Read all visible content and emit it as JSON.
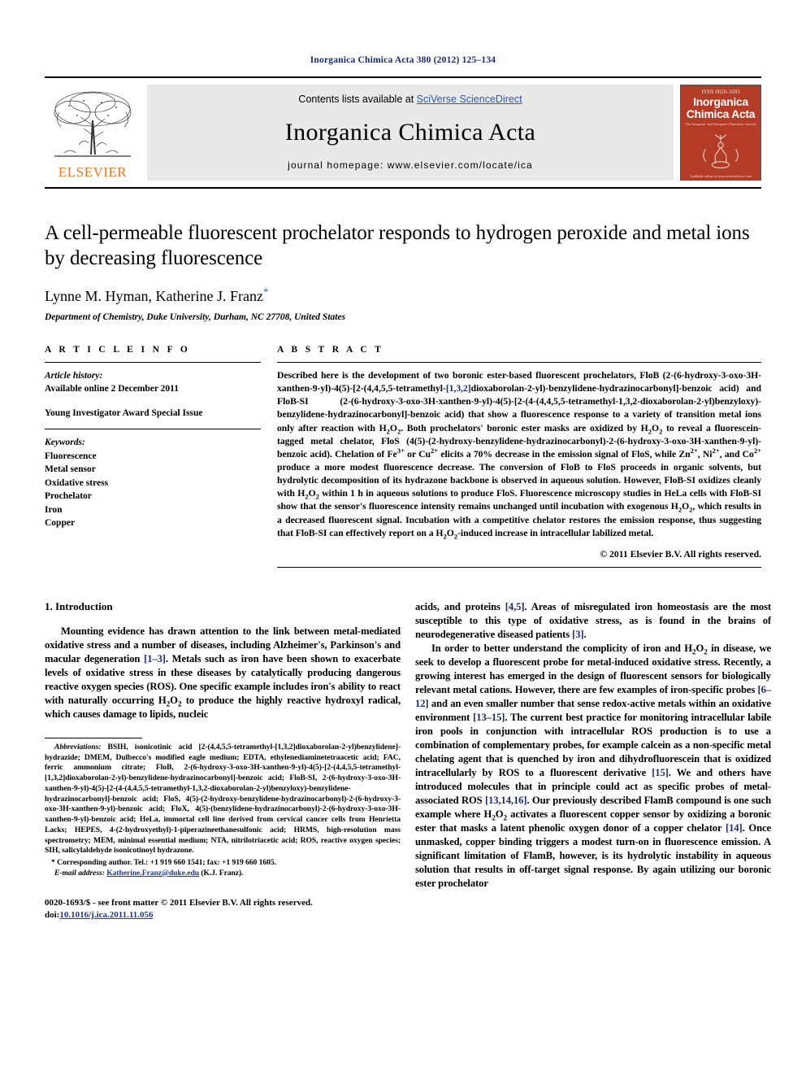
{
  "running_head": "Inorganica Chimica Acta 380 (2012) 125–134",
  "banner": {
    "publisher_name": "ELSEVIER",
    "contents_prefix": "Contents lists available at ",
    "contents_link": "SciVerse ScienceDirect",
    "journal_name": "Inorganica Chimica Acta",
    "homepage": "journal homepage: www.elsevier.com/locate/ica",
    "cover": {
      "issn_top": "ISSN 0020-1693",
      "title_line1": "Inorganica",
      "title_line2": "Chimica Acta",
      "subtitle": "The Inorganic and Inorganic Chemistry Journal",
      "footer": "Available online at www.sciencedirect.com"
    }
  },
  "article": {
    "title": "A cell-permeable fluorescent prochelator responds to hydrogen peroxide and metal ions by decreasing fluorescence",
    "authors": "Lynne M. Hyman, Katherine J. Franz",
    "corresponding_marker": "*",
    "affiliation": "Department of Chemistry, Duke University, Durham, NC 27708, United States"
  },
  "article_info": {
    "heading": "A R T I C L E    I N F O",
    "history_label": "Article history:",
    "history_value": "Available online 2 December 2011",
    "special_issue": "Young Investigator Award Special Issue",
    "keywords_label": "Keywords:",
    "keywords": [
      "Fluorescence",
      "Metal sensor",
      "Oxidative stress",
      "Prochelator",
      "Iron",
      "Copper"
    ]
  },
  "abstract": {
    "heading": "A B S T R A C T",
    "text": "Described here is the development of two boronic ester-based fluorescent prochelators, FloB (2-(6-hydroxy-3-oxo-3H-xanthen-9-yl)-4(5)-[2-(4,4,5,5-tetramethyl-[1,3,2]dioxaborolan-2-yl)-benzylidene-hydrazinocarbonyl]-benzoic acid) and FloB-SI (2-(6-hydroxy-3-oxo-3H-xanthen-9-yl)-4(5)-[2-(4-(4,4,5,5-tetramethyl-1,3,2-dioxaborolan-2-yl)benzyloxy)-benzylidene-hydrazinocarbonyl]-benzoic acid) that show a fluorescence response to a variety of transition metal ions only after reaction with H2O2. Both prochelators' boronic ester masks are oxidized by H2O2 to reveal a fluorescein-tagged metal chelator, FloS (4(5)-(2-hydroxy-benzylidene-hydrazinocarbonyl)-2-(6-hydroxy-3-oxo-3H-xanthen-9-yl)-benzoic acid). Chelation of Fe3+ or Cu2+ elicits a 70% decrease in the emission signal of FloS, while Zn2+, Ni2+, and Co2+ produce a more modest fluorescence decrease. The conversion of FloB to FloS proceeds in organic solvents, but hydrolytic decomposition of its hydrazone backbone is observed in aqueous solution. However, FloB-SI oxidizes cleanly with H2O2 within 1 h in aqueous solutions to produce FloS. Fluorescence microscopy studies in HeLa cells with FloB-SI show that the sensor's fluorescence intensity remains unchanged until incubation with exogenous H2O2, which results in a decreased fluorescent signal. Incubation with a competitive chelator restores the emission response, thus suggesting that FloB-SI can effectively report on a H2O2-induced increase in intracellular labilized metal.",
    "copyright": "© 2011 Elsevier B.V. All rights reserved."
  },
  "body": {
    "section_number_title": "1. Introduction",
    "left_paragraph_1": "Mounting evidence has drawn attention to the link between metal-mediated oxidative stress and a number of diseases, including Alzheimer's, Parkinson's and macular degeneration [1–3]. Metals such as iron have been shown to exacerbate levels of oxidative stress in these diseases by catalytically producing dangerous reactive oxygen species (ROS). One specific example includes iron's ability to react with naturally occurring H2O2 to produce the highly reactive hydroxyl radical, which causes damage to lipids, nucleic",
    "right_paragraph_1_cont": "acids, and proteins [4,5]. Areas of misregulated iron homeostasis are the most susceptible to this type of oxidative stress, as is found in the brains of neurodegenerative diseased patients [3].",
    "right_paragraph_2": "In order to better understand the complicity of iron and H2O2 in disease, we seek to develop a fluorescent probe for metal-induced oxidative stress. Recently, a growing interest has emerged in the design of fluorescent sensors for biologically relevant metal cations. However, there are few examples of iron-specific probes [6–12] and an even smaller number that sense redox-active metals within an oxidative environment [13–15]. The current best practice for monitoring intracellular labile iron pools in conjunction with intracellular ROS production is to use a combination of complementary probes, for example calcein as a non-specific metal chelating agent that is quenched by iron and dihydrofluorescein that is oxidized intracellularly by ROS to a fluorescent derivative [15]. We and others have introduced molecules that in principle could act as specific probes of metal-associated ROS [13,14,16]. Our previously described FlamB compound is one such example where H2O2 activates a fluorescent copper sensor by oxidizing a boronic ester that masks a latent phenolic oxygen donor of a copper chelator [14]. Once unmasked, copper binding triggers a modest turn-on in fluorescence emission. A significant limitation of FlamB, however, is its hydrolytic instability in aqueous solution that results in off-target signal response. By again utilizing our boronic ester prochelator"
  },
  "footnotes": {
    "abbrev_label": "Abbreviations:",
    "abbrev_text": "BSIH, isonicotinic acid [2-(4,4,5,5-tetramethyl-[1,3,2]dioxaborolan-2-yl)benzylidene]-hydrazide; DMEM, Dulbecco's modified eagle medium; EDTA, ethylenediaminetetraacetic acid; FAC, ferric ammonium citrate; FloB, 2-(6-hydroxy-3-oxo-3H-xanthen-9-yl)-4(5)-[2-(4,4,5,5-tetramethyl-[1,3,2]dioxaborolan-2-yl)-benzylidene-hydrazinocarbonyl]-benzoic acid; FloB-SI, 2-(6-hydroxy-3-oxo-3H-xanthen-9-yl)-4(5)-[2-(4-(4,4,5,5-tetramethyl-1,3,2-dioxaborolan-2-yl)benzyloxy)-benzylidene-hydrazinocarbonyl]-benzoic acid; FloS, 4(5)-(2-hydroxy-benzylidene-hydrazinocarbonyl)-2-(6-hydroxy-3-oxo-3H-xanthen-9-yl)-benzoic acid; FloX, 4(5)-(benzylidene-hydrazinocarbonyl)-2-(6-hydroxy-3-oxo-3H-xanthen-9-yl)-benzoic acid; HeLa, immortal cell line derived from cervical cancer cells from Henrietta Lacks; HEPES, 4-(2-hydroxyethyl)-1-piperazineethanesulfonic acid; HRMS, high-resolution mass spectrometry; MEM, minimal essential medium; NTA, nitrilotriacetic acid; ROS, reactive oxygen species; SIH, salicylaldehyde isonicotinoyl hydrazone.",
    "corresponding": "Corresponding author. Tel.: +1 919 660 1541; fax: +1 919 660 1605.",
    "email_label": "E-mail address:",
    "email": "Katherine.Franz@duke.edu",
    "email_suffix": "(K.J. Franz).",
    "issn_line": "0020-1693/$ - see front matter © 2011 Elsevier B.V. All rights reserved.",
    "doi_label": "doi:",
    "doi_value": "10.1016/j.ica.2011.11.056"
  },
  "colors": {
    "link": "#2a5db0",
    "reference": "#1a2a6c",
    "elsevier_orange": "#E87722",
    "cover_red": "#b43b25",
    "banner_grey": "#e9e9e9"
  }
}
